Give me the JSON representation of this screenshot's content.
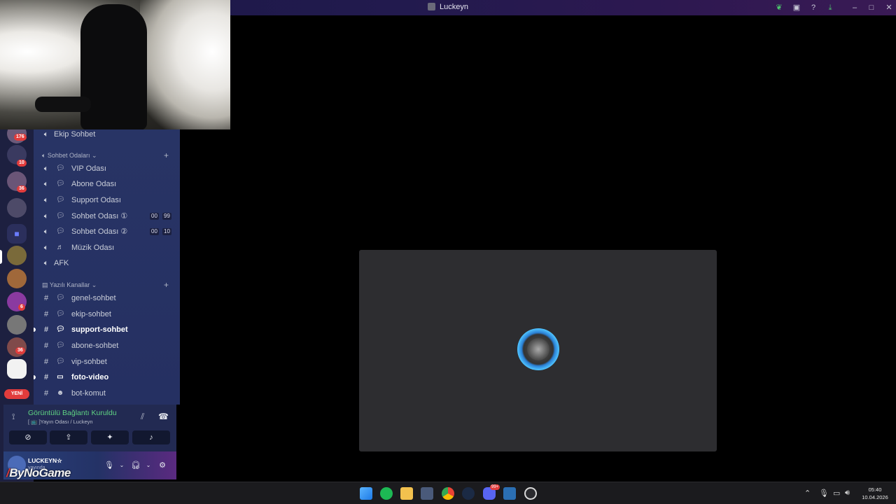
{
  "window": {
    "title": "Luckeyn"
  },
  "servers": {
    "badges": [
      "176",
      "10",
      "36",
      "6",
      "36"
    ],
    "new_label": "YENİ"
  },
  "channels": {
    "top_item": "Ekip Sohbet",
    "voice_category": "Sohbet Odaları",
    "voice_items": [
      {
        "label": "VIP Odası"
      },
      {
        "label": "Abone Odası"
      },
      {
        "label": "Support Odası"
      },
      {
        "label": "Sohbet Odası ①",
        "count_a": "00",
        "count_b": "99"
      },
      {
        "label": "Sohbet Odası ②",
        "count_a": "00",
        "count_b": "10"
      },
      {
        "label": "Müzik Odası"
      },
      {
        "label": "AFK"
      }
    ],
    "text_category": "Yazılı Kanallar",
    "text_items": [
      {
        "label": "genel-sohbet"
      },
      {
        "label": "ekip-sohbet"
      },
      {
        "label": "support-sohbet"
      },
      {
        "label": "abone-sohbet"
      },
      {
        "label": "vip-sohbet"
      },
      {
        "label": "foto-video"
      },
      {
        "label": "bot-komut"
      }
    ]
  },
  "voice_panel": {
    "status": "Görüntülü Bağlantı Kuruldu",
    "location": "[ 📺 ]Yayın Odası / Luckeyn"
  },
  "user": {
    "name": "LUCKEYN☆",
    "status": "yayında"
  },
  "watermark": {
    "prefix": "/",
    "text": "ByNoGame"
  },
  "taskbar": {
    "time": "05:40",
    "date": "10.04.2026",
    "discord_badge": "99+"
  },
  "colors": {
    "voice_connected": "#5fd383",
    "badge_red": "#e23c3c",
    "channel_panel": "#283465"
  }
}
